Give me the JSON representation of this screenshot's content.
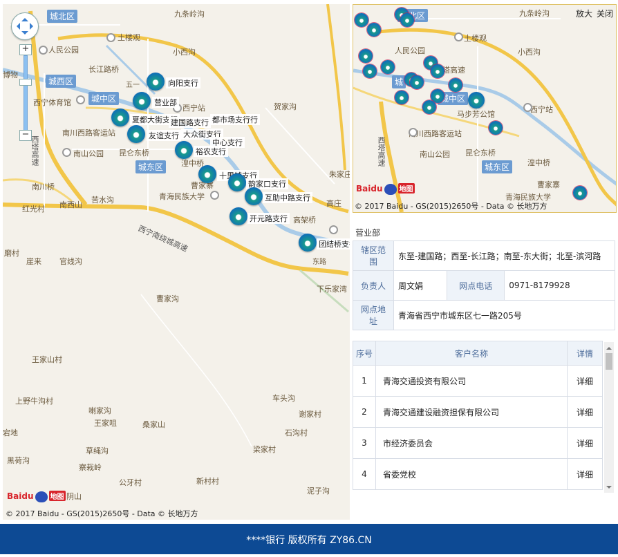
{
  "main_map": {
    "districts": [
      "城北区",
      "城西区",
      "城中区",
      "城东区"
    ],
    "places": [
      "九条岭沟",
      "土楼观",
      "人民公园",
      "小西沟",
      "长江路桥",
      "西宁体育馆",
      "西宁站",
      "贺家沟",
      "南川西路客运站",
      "南山公园",
      "昆仑东桥",
      "湟中桥",
      "曹家寨",
      "朱家庄",
      "青海民族大学",
      "高庄",
      "南川桥",
      "苦水沟",
      "南西山",
      "红光村",
      "高架桥",
      "磨村",
      "崖来",
      "官线沟",
      "下乐家湾",
      "曹家沟",
      "王家山村",
      "上野牛沟村",
      "喇家沟",
      "车头沟",
      "谢家村",
      "王家咀",
      "桑家山",
      "石沟村",
      "草绳沟",
      "梁家村",
      "黑荷沟",
      "察栽岭",
      "公牙村",
      "新村村",
      "阴山",
      "泥子沟",
      "宕地",
      "博物",
      "五一",
      "东路"
    ],
    "roads": [
      "西塔高速",
      "西宁南绕城高速"
    ],
    "branches": [
      {
        "label": "向阳支行"
      },
      {
        "label": "营业部"
      },
      {
        "label": "夏都大街支行"
      },
      {
        "label": "建国路支行"
      },
      {
        "label": "友谊支行"
      },
      {
        "label": "大众街支行"
      },
      {
        "label": "中心支行"
      },
      {
        "label": "裕农支行"
      },
      {
        "label": "十里铺支行"
      },
      {
        "label": "韵家口支行"
      },
      {
        "label": "互助中路支行"
      },
      {
        "label": "开元路支行"
      },
      {
        "label": "团结桥支行"
      },
      {
        "label": "都市场支行行"
      }
    ],
    "baidu_logo": "Baidu",
    "baidu_tag": "地图",
    "copyright": "© 2017 Baidu - GS(2015)2650号 - Data © 长地万方"
  },
  "mini_map": {
    "districts": [
      "城北区",
      "城中区",
      "城东区"
    ],
    "places": [
      "九条岭沟",
      "土楼观",
      "人民公园",
      "小西沟",
      "马步芳公馆",
      "西宁站",
      "南川西路客运站",
      "南山公园",
      "昆仑东桥",
      "湟中桥",
      "曹家寨",
      "青海民族大学",
      "西塔高速",
      "路桥",
      "城"
    ],
    "tools": [
      "放大",
      "关闭"
    ],
    "baidu_logo": "Baidu",
    "baidu_tag": "地图",
    "copyright": "© 2017 Baidu - GS(2015)2650号 - Data © 长地万方"
  },
  "detail": {
    "branch_name": "营业部",
    "area_label": "辖区范围",
    "area_value": "东至-建国路；西至-长江路；南至-东大街；北至-滨河路",
    "manager_label": "负责人",
    "manager_value": "周文娟",
    "phone_label": "网点电话",
    "phone_value": "0971-8179928",
    "address_label": "网点地址",
    "address_value": "青海省西宁市城东区七一路205号"
  },
  "clients": {
    "headers": [
      "序号",
      "客户名称",
      "详情"
    ],
    "rows": [
      {
        "no": "1",
        "name": "青海交通投资有限公司",
        "action": "详细"
      },
      {
        "no": "2",
        "name": "青海交通建设融资担保有限公司",
        "action": "详细"
      },
      {
        "no": "3",
        "name": "市经济委员会",
        "action": "详细"
      },
      {
        "no": "4",
        "name": "省委党校",
        "action": "详细"
      }
    ]
  },
  "footer": {
    "text": "****银行 版权所有 ZY86.CN"
  }
}
